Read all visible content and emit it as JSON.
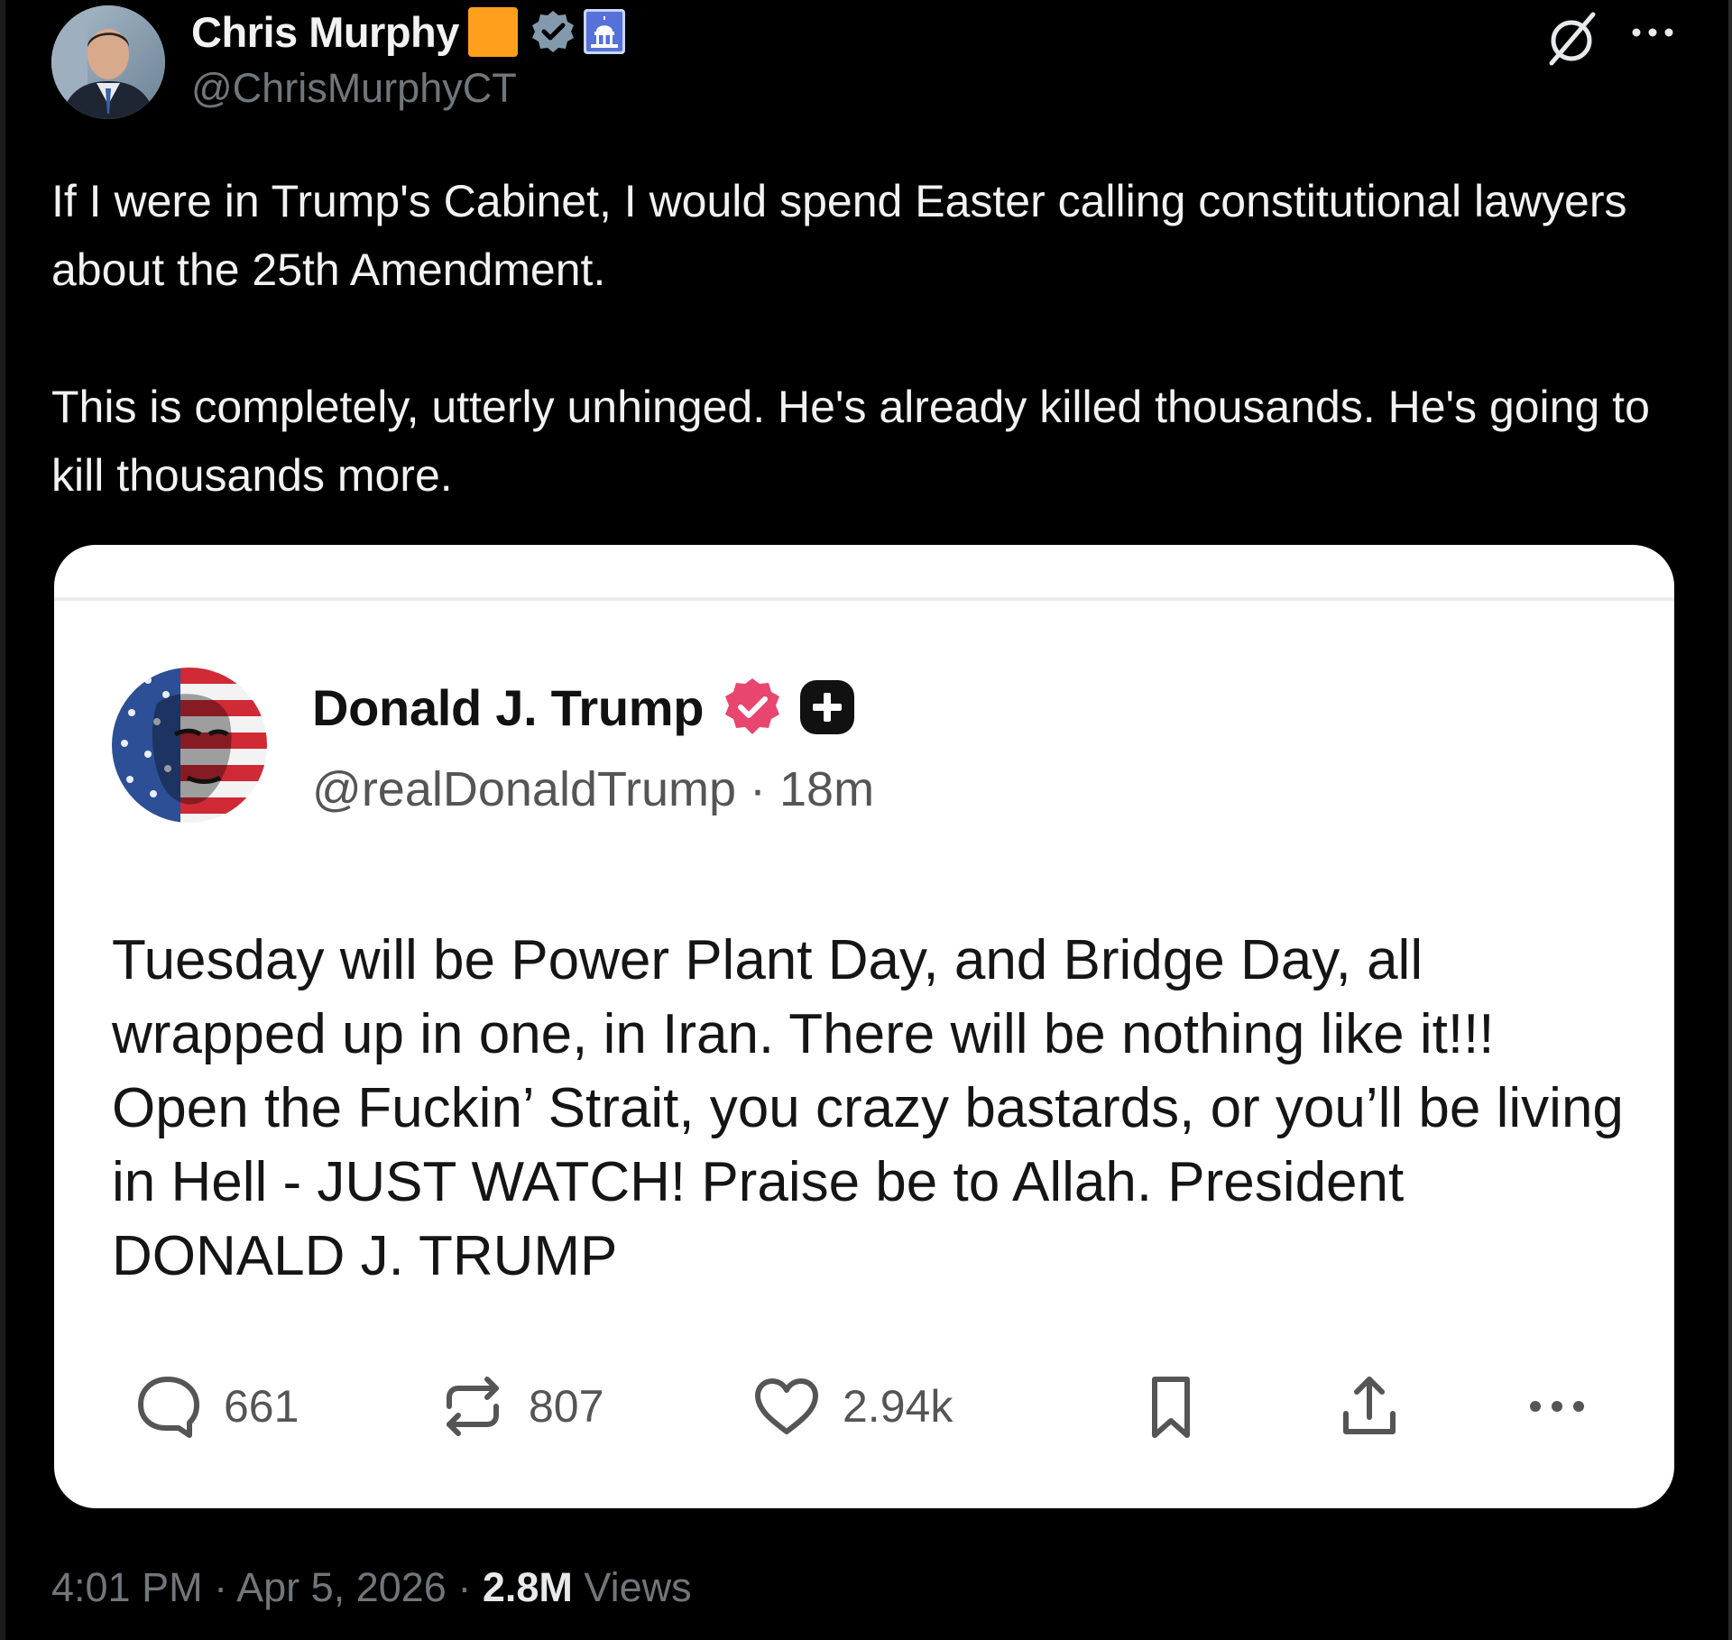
{
  "post": {
    "author_name": "Chris Murphy",
    "author_handle": "@ChrisMurphyCT",
    "body": [
      "If I were in Trump's Cabinet, I would spend Easter calling constitutional lawyers about the 25th Amendment.",
      "This is completely, utterly unhinged. He's already killed thousands. He's going to kill thousands more."
    ],
    "time": "4:01 PM",
    "date": "Apr 5, 2026",
    "views_count": "2.8M",
    "views_label": "Views",
    "separator": "·",
    "icons": {
      "avatar": "profile-photo",
      "badge_1": "orange-square",
      "badge_2": "verified-gear-badge",
      "badge_3": "capitol-building-badge",
      "grok": "grok-icon",
      "more": "more-horizontal-icon"
    },
    "colors": {
      "background": "#000000",
      "text": "#e7e9ea",
      "secondary_text": "#71767b",
      "orange_badge": "#ff9f1c"
    }
  },
  "embedded_post": {
    "author_name": "Donald J. Trump",
    "author_handle": "@realDonaldTrump",
    "time_ago": "18m",
    "separator": "·",
    "body": "Tuesday will be Power Plant Day, and Bridge Day, all wrapped up in one, in Iran. There will be nothing like it!!! Open the Fuckin’ Strait, you crazy bastards, or you’ll be living in Hell - JUST WATCH! Praise be to Allah. President DONALD J. TRUMP",
    "actions": {
      "replies": "661",
      "reposts": "807",
      "likes": "2.94k"
    },
    "icons": {
      "avatar": "flag-face-avatar",
      "verified": "verified-badge",
      "plus": "plus-badge",
      "reply": "reply-icon",
      "repost": "repost-icon",
      "like": "heart-icon",
      "bookmark": "bookmark-icon",
      "share": "share-icon",
      "more": "more-horizontal-icon"
    },
    "colors": {
      "card_background": "#ffffff",
      "verified_badge": "#e8466f",
      "text": "#151515",
      "secondary_text": "#555555"
    }
  }
}
